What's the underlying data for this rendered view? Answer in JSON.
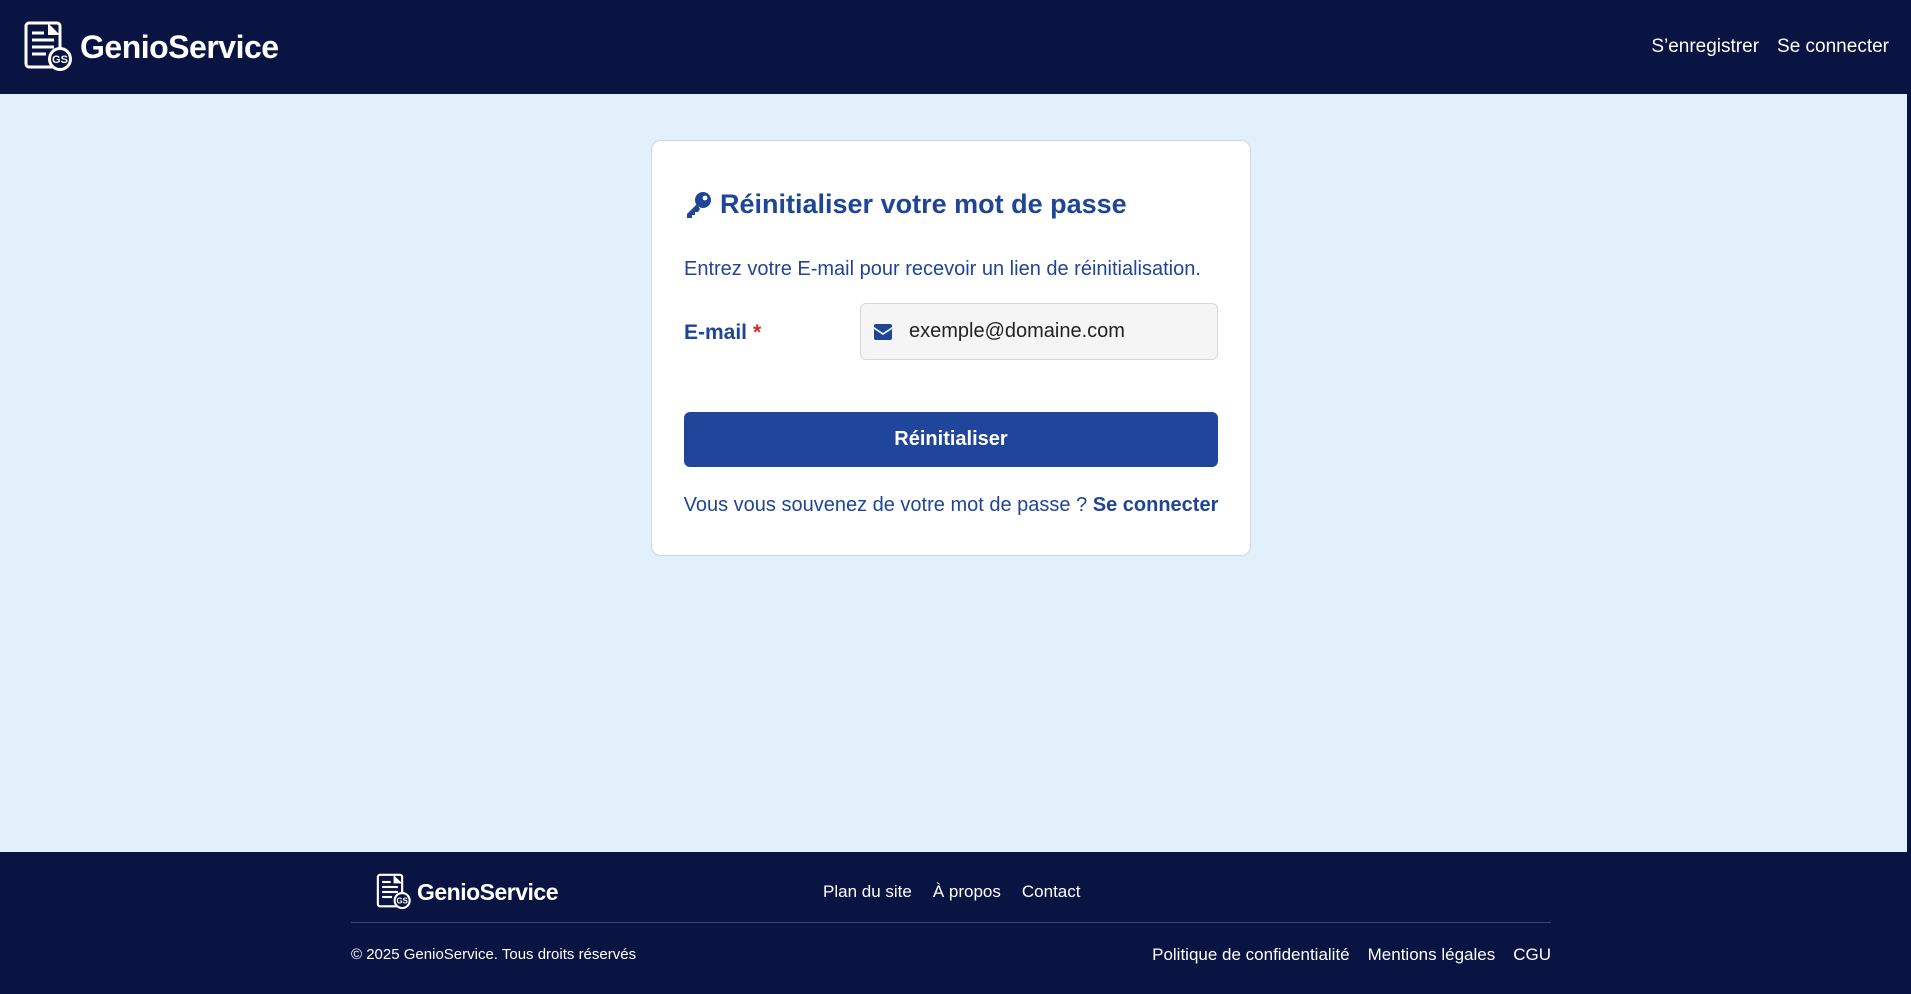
{
  "brand": {
    "name": "GenioService",
    "mark_text": "GS"
  },
  "header": {
    "nav": [
      {
        "label": "S’enregistrer"
      },
      {
        "label": "Se connecter"
      }
    ]
  },
  "reset_card": {
    "title": "Réinitialiser votre mot de passe",
    "description": "Entrez votre E-mail pour recevoir un lien de réinitialisation.",
    "email_label": "E-mail",
    "required_mark": "*",
    "email_placeholder": "exemple@domaine.com",
    "submit_label": "Réinitialiser",
    "remember_text": "Vous vous souvenez de votre mot de passe ?",
    "login_link": "Se connecter"
  },
  "footer": {
    "links": [
      {
        "label": "Plan du site"
      },
      {
        "label": "À propos"
      },
      {
        "label": "Contact"
      }
    ],
    "copyright": "© 2025 GenioService. Tous droits réservés",
    "legal": [
      {
        "label": "Politique de confidentialité"
      },
      {
        "label": "Mentions légales"
      },
      {
        "label": "CGU"
      }
    ]
  },
  "colors": {
    "header_bg": "#091442",
    "page_bg": "#e2f0fb",
    "accent": "#20469c",
    "required": "#d12b2b"
  },
  "icons": [
    "document-gear-logo-icon",
    "key-icon",
    "envelope-icon"
  ]
}
